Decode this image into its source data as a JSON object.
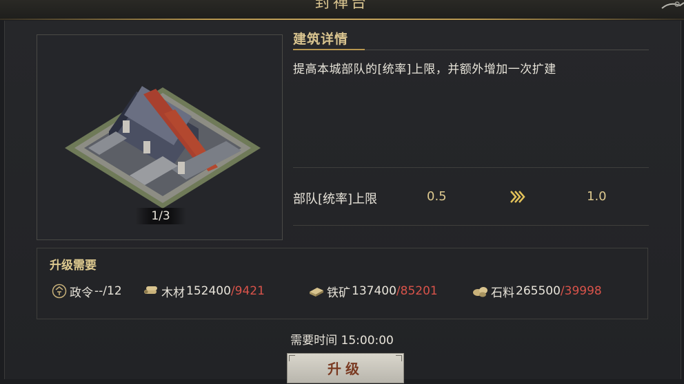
{
  "window": {
    "title": "封禅台"
  },
  "preview": {
    "page_counter": "1/3"
  },
  "details": {
    "heading": "建筑详情",
    "description": "提高本城部队的[统率]上限，并额外增加一次扩建"
  },
  "stat": {
    "label": "部队[统率]上限",
    "current": "0.5",
    "next": "1.0"
  },
  "requirements": {
    "title": "升级需要",
    "items": [
      {
        "icon": "decree-icon",
        "label": "政令",
        "need": "--",
        "have": "/12"
      },
      {
        "icon": "wood-icon",
        "label": "木材",
        "need": "152400",
        "have": "/9421"
      },
      {
        "icon": "iron-icon",
        "label": "铁矿",
        "need": "137400",
        "have": "/85201"
      },
      {
        "icon": "stone-icon",
        "label": "石料",
        "need": "265500",
        "have": "/39998"
      }
    ]
  },
  "time": {
    "text": "需要时间 15:00:00"
  },
  "upgrade_button": {
    "label": "升级"
  },
  "colors": {
    "gold": "#d9c48f",
    "shortage": "#d9534a",
    "text": "#e8e4da"
  }
}
